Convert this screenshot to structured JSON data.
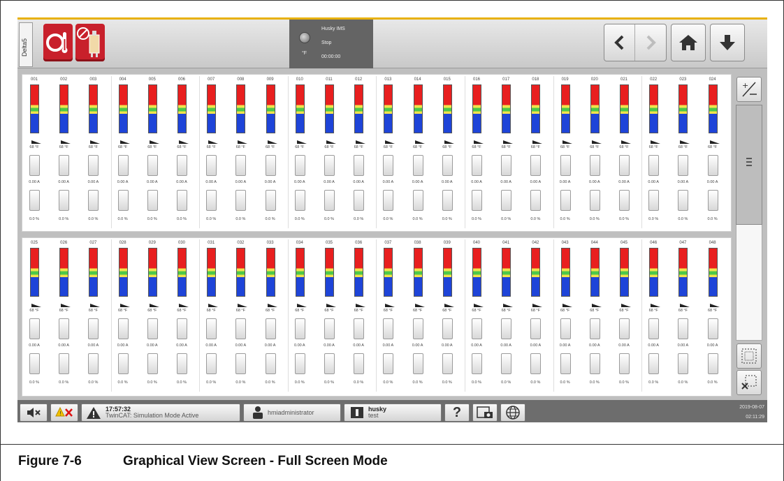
{
  "header": {
    "delta_tab": "Delta5",
    "status_title": "Husky IMS",
    "status_state": "Stop",
    "status_unit": "°F",
    "status_time": "00:00:00"
  },
  "zones_row1": [
    "001",
    "002",
    "003",
    "004",
    "005",
    "006",
    "007",
    "008",
    "009",
    "010",
    "011",
    "012",
    "013",
    "014",
    "015",
    "016",
    "017",
    "018",
    "019",
    "020",
    "021",
    "022",
    "023",
    "024"
  ],
  "zones_row2": [
    "025",
    "026",
    "027",
    "028",
    "029",
    "030",
    "031",
    "032",
    "033",
    "034",
    "035",
    "036",
    "037",
    "038",
    "039",
    "040",
    "041",
    "042",
    "043",
    "044",
    "045",
    "046",
    "047",
    "048"
  ],
  "zone_values": {
    "temperature": "68 °F",
    "current": "0.00 A",
    "output": "0.0 %"
  },
  "footer": {
    "alarm_time": "17:57:32",
    "alarm_message": "TwinCAT: Simulation Mode Active",
    "user": "hmiadministrator",
    "mold_name": "husky",
    "mold_sub": "test",
    "date": "2019-08-07",
    "time": "02:11:29"
  },
  "caption": {
    "figure": "Figure 7-6",
    "title": "Graphical View Screen - Full Screen Mode"
  },
  "colors": {
    "accent": "#e8b10a",
    "red_button": "#c8202b",
    "hot": "#e81f1f",
    "ok": "#4cc84a",
    "cold": "#1e44d8"
  }
}
